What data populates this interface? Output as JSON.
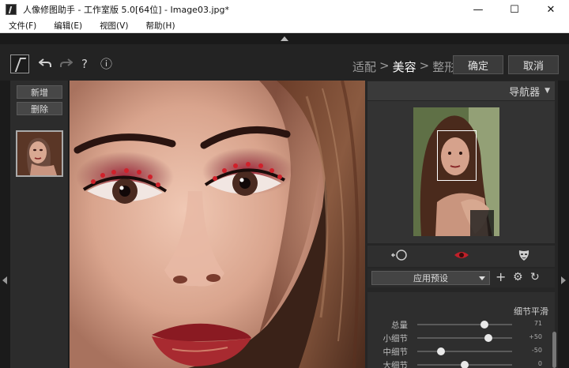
{
  "window": {
    "title": "人像修图助手 - 工作室版 5.0[64位] - Image03.jpg*",
    "minimize": "—",
    "maximize": "☐",
    "close": "✕"
  },
  "menu": [
    {
      "label": "文件(F)"
    },
    {
      "label": "编辑(E)"
    },
    {
      "label": "视图(V)"
    },
    {
      "label": "帮助(H)"
    }
  ],
  "toolbar": {
    "undo_icon": "undo-icon",
    "redo_icon": "redo-icon",
    "help_label": "?",
    "info_label": "ⓘ",
    "steps": [
      "适配",
      ">",
      "美容",
      ">",
      "整形"
    ],
    "active_step": "美容",
    "confirm_label": "确定",
    "cancel_label": "取消"
  },
  "left_panel": {
    "add_label": "新增",
    "delete_label": "删除"
  },
  "navigator": {
    "title": "导航器"
  },
  "tools": {
    "tab_icons": [
      "face-outline-icon",
      "eye-icon",
      "mask-icon"
    ]
  },
  "preset": {
    "label": "应用预设",
    "add": "+",
    "settings": "⚙",
    "reset": "↻"
  },
  "smoothing": {
    "title": "细节平滑",
    "sliders": [
      {
        "label": "总量",
        "value": "71",
        "fraction": 0.71
      },
      {
        "label": "小细节",
        "value": "+50",
        "fraction": 0.75
      },
      {
        "label": "中细节",
        "value": "-50",
        "fraction": 0.25
      },
      {
        "label": "大细节",
        "value": "0",
        "fraction": 0.5
      }
    ]
  },
  "colors": {
    "background": "#232323",
    "panel": "#2c2c2c",
    "active_text": "#ffffff",
    "inactive_text": "#9a9a9a",
    "eye_tool": "#c0202a"
  }
}
